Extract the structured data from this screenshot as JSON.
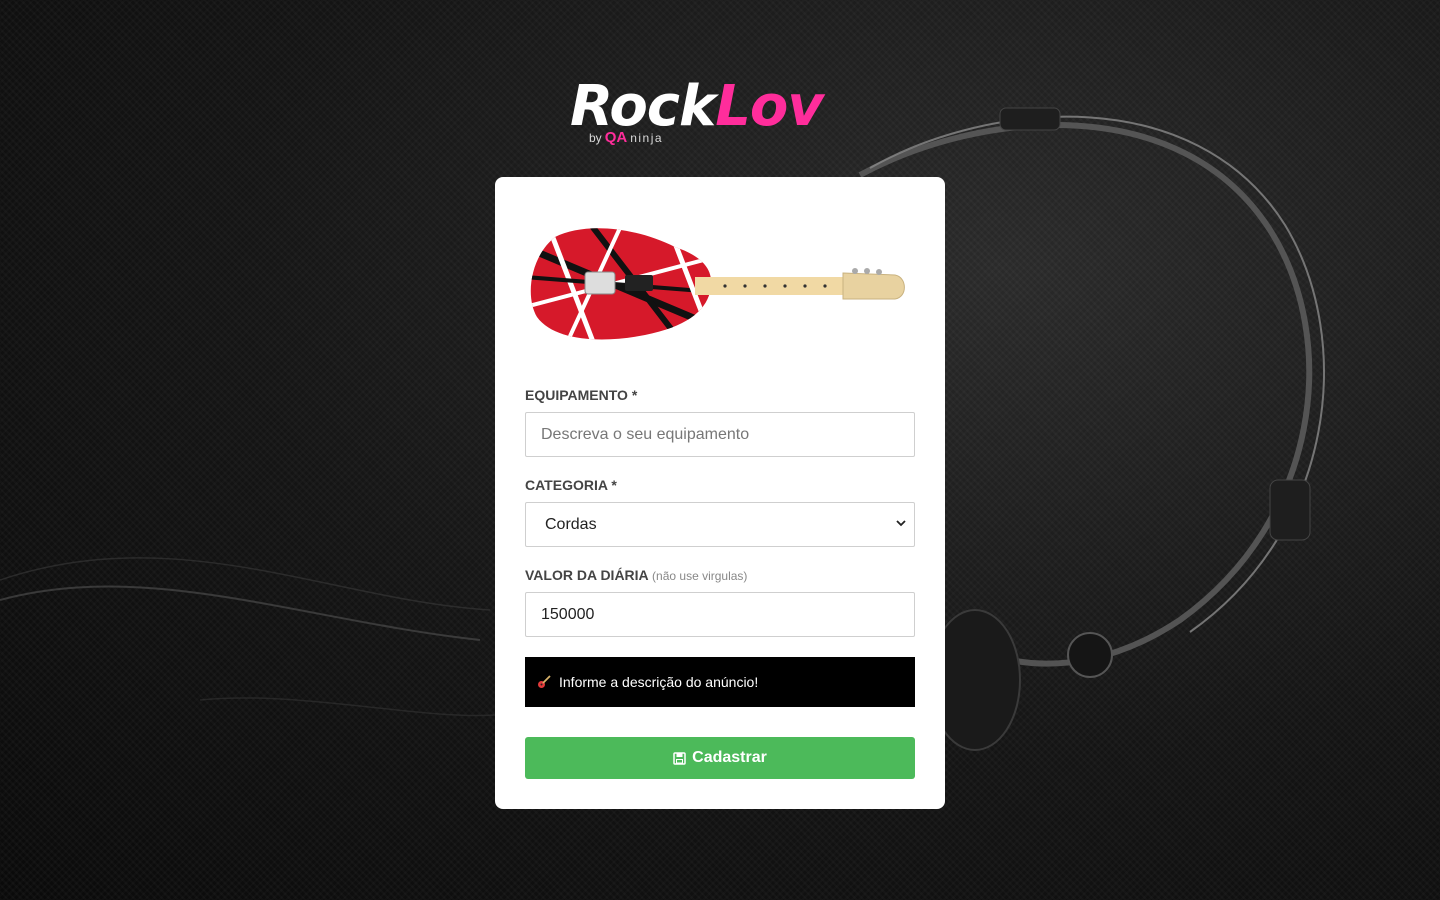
{
  "brand": {
    "name_part1": "Rock",
    "name_part2": "Lov",
    "by": "by",
    "qa": "QA",
    "ninja": "ninja",
    "accent_color": "#ff2d9b"
  },
  "form": {
    "thumbnail_icon": "electric-guitar-image",
    "equipment": {
      "label": "EQUIPAMENTO *",
      "placeholder": "Descreva o seu equipamento",
      "value": ""
    },
    "category": {
      "label": "CATEGORIA *",
      "selected": "Cordas"
    },
    "price": {
      "label": "VALOR DA DIÁRIA",
      "hint": "(não use virgulas)",
      "value": "150000"
    },
    "alert": {
      "icon": "guitar-icon",
      "message": "Informe a descrição do anúncio!"
    },
    "submit": {
      "icon": "save-icon",
      "label": "Cadastrar",
      "color": "#4cba5a"
    }
  }
}
